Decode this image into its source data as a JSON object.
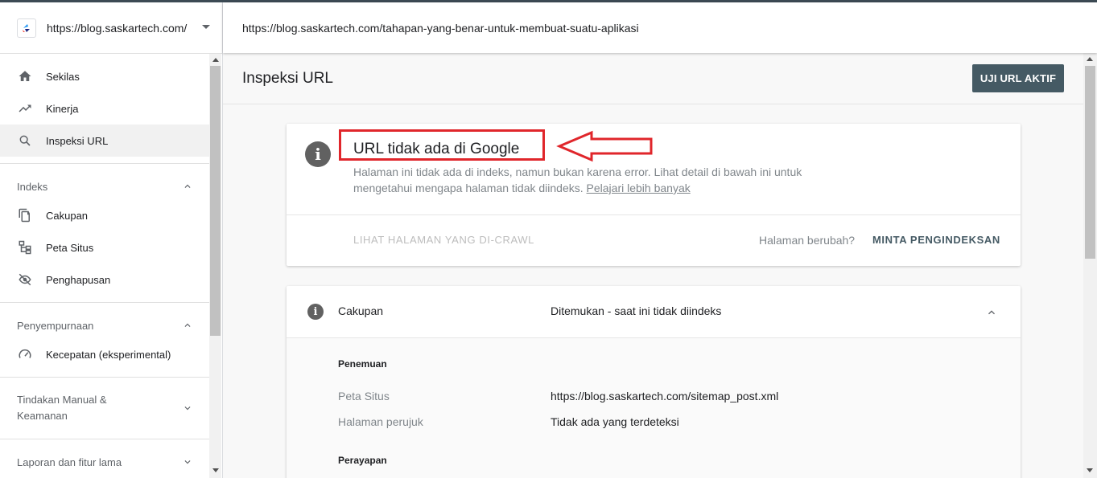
{
  "property": {
    "url": "https://blog.saskartech.com/"
  },
  "inspected_url": "https://blog.saskartech.com/tahapan-yang-benar-untuk-membuat-suatu-aplikasi",
  "nav": {
    "items": [
      {
        "label": "Sekilas",
        "icon": "home-icon"
      },
      {
        "label": "Kinerja",
        "icon": "trending-up-icon"
      },
      {
        "label": "Inspeksi URL",
        "icon": "search-icon"
      }
    ],
    "sections": [
      {
        "title": "Indeks",
        "items": [
          "Cakupan",
          "Peta Situs",
          "Penghapusan"
        ]
      },
      {
        "title": "Penyempurnaan",
        "items": [
          "Kecepatan (eksperimental)"
        ]
      },
      {
        "title": "Tindakan Manual & Keamanan"
      },
      {
        "title": "Laporan dan fitur lama"
      }
    ]
  },
  "page": {
    "title": "Inspeksi URL",
    "test_live_button": "UJI URL AKTIF"
  },
  "status_card": {
    "title": "URL tidak ada di Google",
    "description": "Halaman ini tidak ada di indeks, namun bukan karena error. Lihat detail di bawah ini untuk mengetahui mengapa halaman tidak diindeks.",
    "learn_more": "Pelajari lebih banyak",
    "view_crawled": "LIHAT HALAMAN YANG DI-CRAWL",
    "page_changed": "Halaman berubah?",
    "request_indexing": "MINTA PENGINDEKSAN",
    "highlight_color": "#e0262b"
  },
  "coverage": {
    "label": "Cakupan",
    "value": "Ditemukan - saat ini tidak diindeks",
    "discovery_heading": "Penemuan",
    "rows": [
      {
        "key": "Peta Situs",
        "value": "https://blog.saskartech.com/sitemap_post.xml"
      },
      {
        "key": "Halaman perujuk",
        "value": "Tidak ada yang terdeteksi"
      }
    ],
    "crawl_heading": "Perayapan"
  }
}
